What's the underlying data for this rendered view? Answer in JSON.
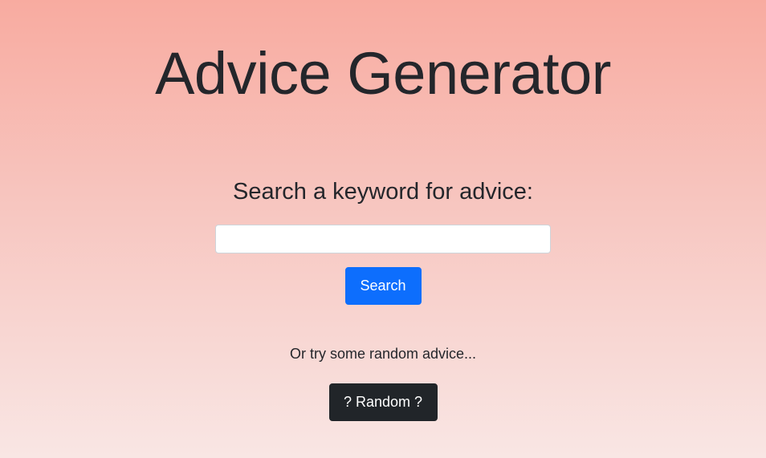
{
  "header": {
    "title": "Advice Generator"
  },
  "search": {
    "prompt": "Search a keyword for advice:",
    "input_value": "",
    "placeholder": "",
    "button_label": "Search"
  },
  "random": {
    "prompt": "Or try some random advice...",
    "button_label": "? Random ?"
  },
  "colors": {
    "gradient_top": "#f8aba0",
    "gradient_bottom": "#f9e6e4",
    "primary_button": "#0d6efd",
    "dark_button": "#212529",
    "text": "#24262b"
  }
}
